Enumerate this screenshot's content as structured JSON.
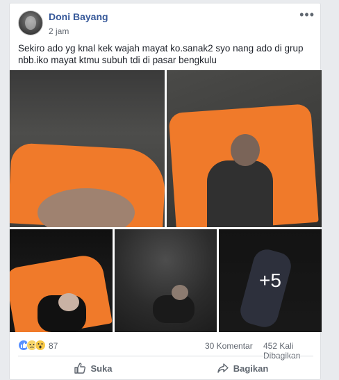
{
  "post": {
    "author": "Doni Bayang",
    "time": "2 jam",
    "more": "•••",
    "text": "Sekiro ado yg knal kek wajah mayat ko.sanak2 syo nang ado di grup nbb.iko mayat ktmu subuh tdi di pasar bengkulu"
  },
  "photos": {
    "extra_count": "+5"
  },
  "stats": {
    "reaction_icons": [
      "like-icon",
      "sad-icon",
      "wow-icon"
    ],
    "reaction_count": "87",
    "comments": "30 Komentar",
    "shares": "452 Kali Dibagikan"
  },
  "actions": {
    "like_label": "Suka",
    "share_label": "Bagikan"
  },
  "colors": {
    "link": "#365899",
    "bag_orange": "#f07a2a",
    "like_blue": "#5890ff"
  }
}
